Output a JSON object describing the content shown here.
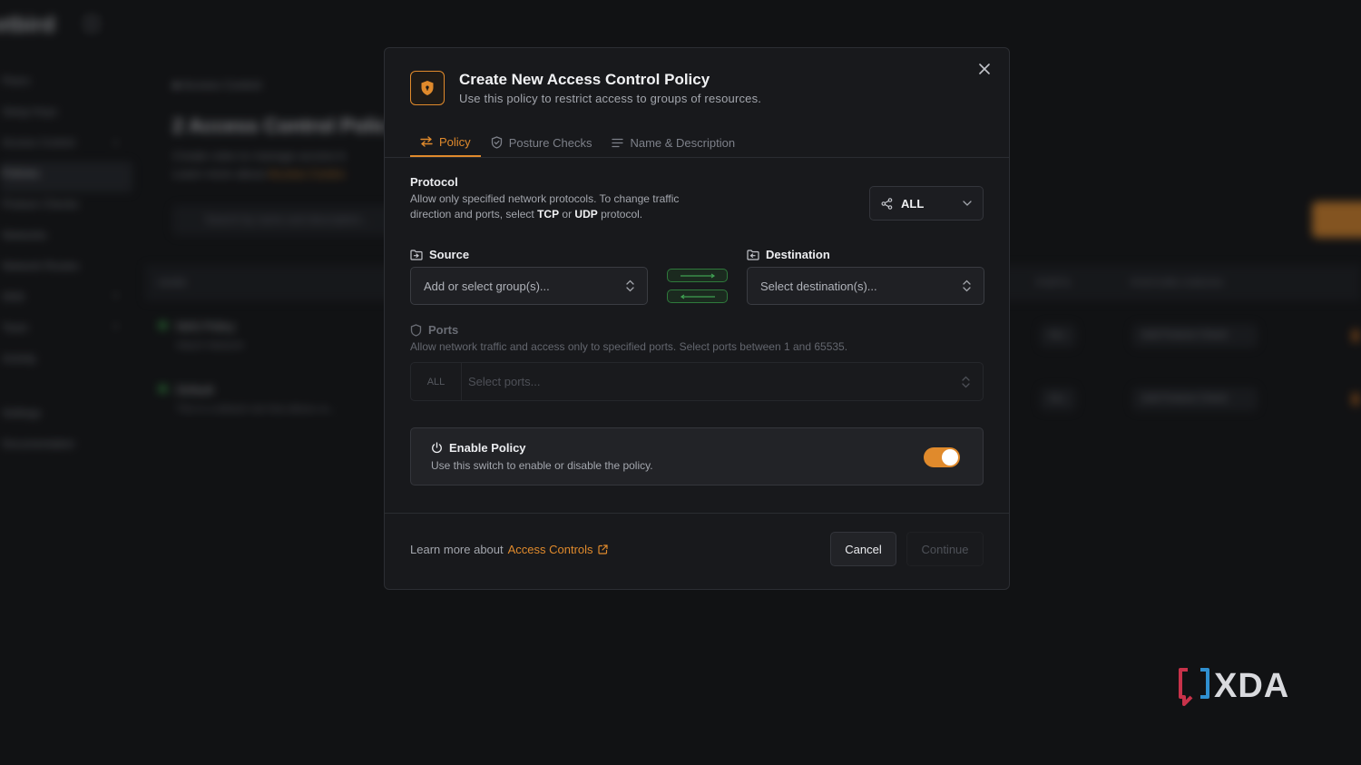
{
  "background": {
    "logo": "etbird",
    "sidebar_items": [
      {
        "label": "Peers",
        "chevron": false,
        "active": false
      },
      {
        "label": "Setup Keys",
        "chevron": false,
        "active": false
      },
      {
        "label": "Access Control",
        "chevron": true,
        "active": false
      },
      {
        "label": "Policies",
        "chevron": false,
        "active": true
      },
      {
        "label": "Posture Checks",
        "chevron": false,
        "active": false
      },
      {
        "label": "Networks",
        "chevron": false,
        "active": false
      },
      {
        "label": "Network Routes",
        "chevron": false,
        "active": false
      },
      {
        "label": "DNS",
        "chevron": true,
        "active": false
      },
      {
        "label": "Team",
        "chevron": true,
        "active": false
      },
      {
        "label": "Activity",
        "chevron": false,
        "active": false
      }
    ],
    "sidebar_bottom": [
      {
        "label": "Settings"
      },
      {
        "label": "Documentation"
      }
    ],
    "breadcrumb": "Access Control",
    "page_title": "2 Access Control Polic",
    "page_desc_line1": "Create rules to manage access b",
    "page_desc_line2_prefix": "Learn more about ",
    "page_desc_line2_link": "Access Contro",
    "search_placeholder": "Search by name and description...",
    "table_headers": [
      "NAME",
      "PORTS",
      "POSTURE CHECKS"
    ],
    "rows": [
      {
        "title": "NAS Policy",
        "sub": "Attach Network",
        "ports": "ALL",
        "posture": "Add Posture Check"
      },
      {
        "title": "Default",
        "sub": "This is a default rule that allows co...",
        "ports": "ALL",
        "posture": "Add Posture Check"
      }
    ]
  },
  "modal": {
    "title": "Create New Access Control Policy",
    "subtitle": "Use this policy to restrict access to groups of resources.",
    "close_label": "×",
    "tabs": [
      {
        "label": "Policy",
        "icon": "arrows-exchange-icon",
        "active": true
      },
      {
        "label": "Posture Checks",
        "icon": "shield-check-icon",
        "active": false
      },
      {
        "label": "Name & Description",
        "icon": "text-lines-icon",
        "active": false
      }
    ],
    "protocol": {
      "label": "Protocol",
      "desc_line1": "Allow only specified network protocols. To change traffic",
      "desc_line2_a": "direction and ports, select ",
      "desc_tcp": "TCP",
      "desc_or": " or ",
      "desc_udp": "UDP",
      "desc_line2_b": " protocol.",
      "value": "ALL"
    },
    "source": {
      "label": "Source",
      "placeholder": "Add or select group(s)..."
    },
    "destination": {
      "label": "Destination",
      "placeholder": "Select destination(s)..."
    },
    "ports": {
      "label": "Ports",
      "desc": "Allow network traffic and access only to specified ports. Select ports between 1 and 65535.",
      "all_label": "ALL",
      "placeholder": "Select ports..."
    },
    "enable": {
      "title": "Enable Policy",
      "desc": "Use this switch to enable or disable the policy.",
      "enabled": true
    },
    "footer": {
      "learn_prefix": "Learn more about",
      "learn_link": "Access Controls",
      "cancel": "Cancel",
      "continue": "Continue"
    }
  },
  "watermark": {
    "text": "XDA"
  },
  "colors": {
    "accent": "#e08a2c",
    "green": "#2f7a3c",
    "modal_bg": "#18191c",
    "page_bg": "#111214"
  }
}
